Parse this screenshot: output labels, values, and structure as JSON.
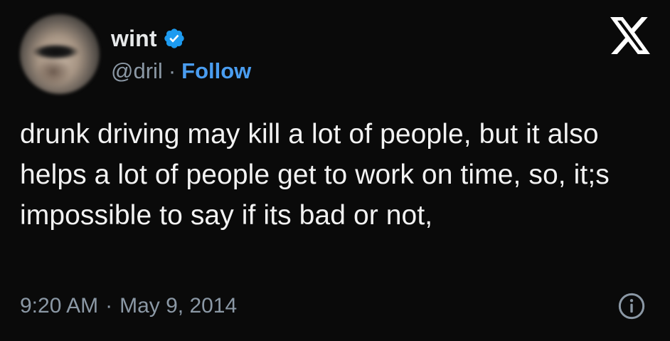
{
  "tweet": {
    "author": {
      "display_name": "wint",
      "handle": "@dril",
      "verified": true
    },
    "follow_label": "Follow",
    "separator": "·",
    "text": "drunk driving may kill a lot of people, but it also helps a lot of people get to work on time, so, it;s impossible to say if its bad or not,",
    "time": "9:20 AM",
    "date": "May 9, 2014"
  },
  "icons": {
    "verified": "verified-badge-icon",
    "logo": "x-logo-icon",
    "info": "info-icon"
  },
  "colors": {
    "background": "#0a0a0a",
    "text": "#e7e9ea",
    "muted": "#8b98a5",
    "link": "#4a9df0",
    "verified": "#1d9bf0"
  }
}
